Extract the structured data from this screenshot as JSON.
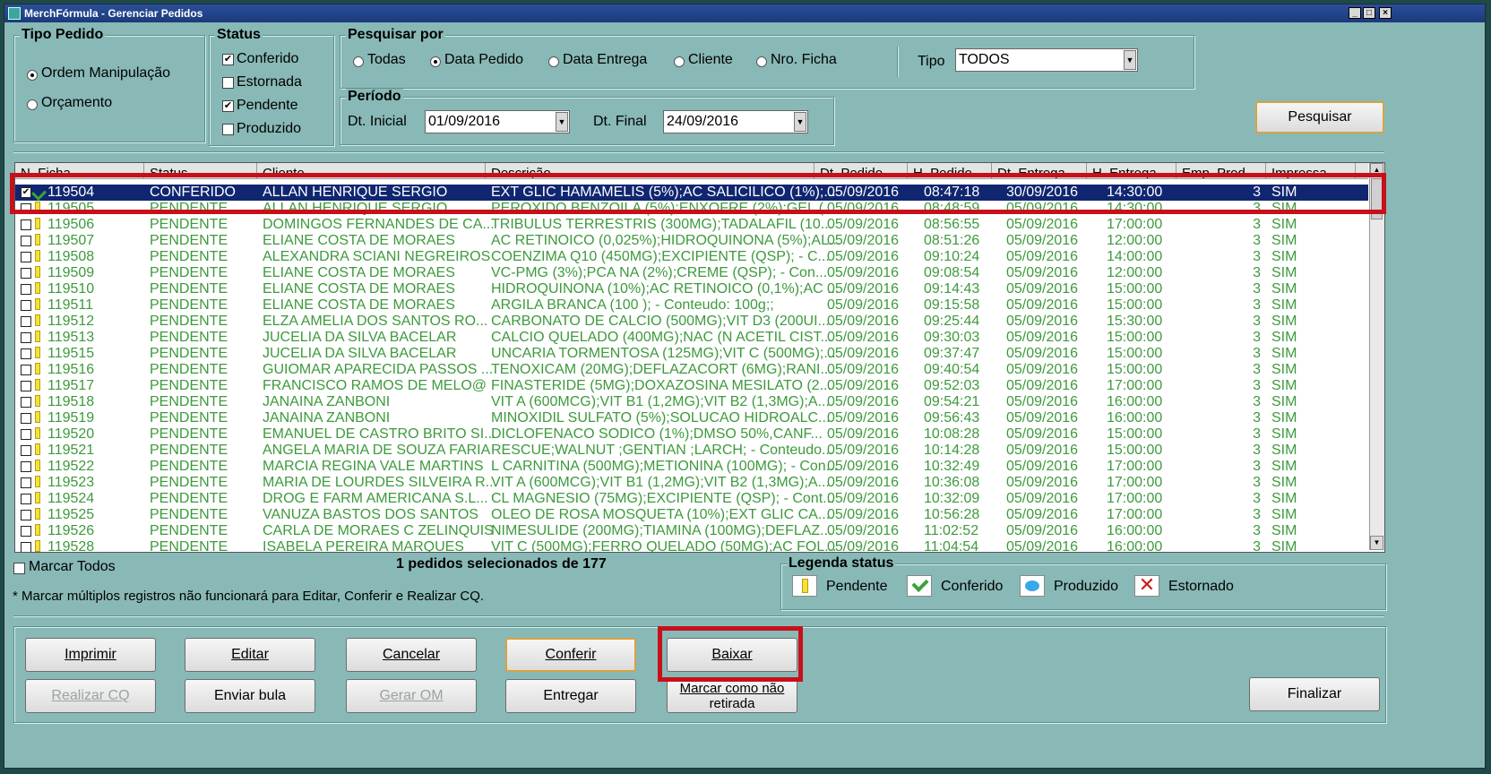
{
  "window": {
    "title": "MerchFórmula - Gerenciar Pedidos",
    "min": "_",
    "max": "□",
    "close": "×"
  },
  "tipo_pedido": {
    "label": "Tipo Pedido",
    "options": [
      "Ordem Manipulação",
      "Orçamento"
    ],
    "selected": 0
  },
  "status": {
    "label": "Status",
    "options": [
      {
        "label": "Conferido",
        "checked": true
      },
      {
        "label": "Estornada",
        "checked": false
      },
      {
        "label": "Pendente",
        "checked": true
      },
      {
        "label": "Produzido",
        "checked": false
      }
    ]
  },
  "pesquisar_por": {
    "label": "Pesquisar por",
    "options": [
      "Todas",
      "Data Pedido",
      "Data Entrega",
      "Cliente",
      "Nro. Ficha"
    ],
    "selected": 1,
    "tipo_label": "Tipo",
    "tipo_value": "TODOS"
  },
  "periodo": {
    "label": "Período",
    "dt_inicial_label": "Dt. Inicial",
    "dt_inicial": "01/09/2016",
    "dt_final_label": "Dt. Final",
    "dt_final": "24/09/2016"
  },
  "pesquisar_button": "Pesquisar",
  "columns": [
    "N. Ficha",
    "Status",
    "Cliente",
    "Descrição",
    "Dt. Pedido",
    "H. Pedido",
    "Dt. Entrega",
    "H. Entrega",
    "Emp. Prod.",
    "Impressa"
  ],
  "rows": [
    [
      "119504",
      "CONFERIDO",
      "ALLAN HENRIQUE SERGIO",
      "EXT GLIC HAMAMELIS (5%);AC SALICILICO (1%);...",
      "05/09/2016",
      "08:47:18",
      "30/09/2016",
      "14:30:00",
      "3",
      "SIM"
    ],
    [
      "119505",
      "PENDENTE",
      "ALLAN HENRIQUE SERGIO",
      "PEROXIDO BENZOILA (5%);ENXOFRE (2%);GEL (...",
      "05/09/2016",
      "08:48:59",
      "05/09/2016",
      "14:30:00",
      "3",
      "SIM"
    ],
    [
      "119506",
      "PENDENTE",
      "DOMINGOS FERNANDES DE CA...",
      "TRIBULUS TERRESTRIS (300MG);TADALAFIL (10...",
      "05/09/2016",
      "08:56:55",
      "05/09/2016",
      "17:00:00",
      "3",
      "SIM"
    ],
    [
      "119507",
      "PENDENTE",
      "ELIANE COSTA DE MORAES",
      "AC RETINOICO (0,025%);HIDROQUINONA (5%);AL...",
      "05/09/2016",
      "08:51:26",
      "05/09/2016",
      "12:00:00",
      "3",
      "SIM"
    ],
    [
      "119508",
      "PENDENTE",
      "ALEXANDRA SCIANI NEGREIROS",
      "COENZIMA Q10 (450MG);EXCIPIENTE (QSP); - C...",
      "05/09/2016",
      "09:10:24",
      "05/09/2016",
      "14:00:00",
      "3",
      "SIM"
    ],
    [
      "119509",
      "PENDENTE",
      "ELIANE COSTA DE MORAES",
      "VC-PMG (3%);PCA NA (2%);CREME (QSP); - Con...",
      "05/09/2016",
      "09:08:54",
      "05/09/2016",
      "12:00:00",
      "3",
      "SIM"
    ],
    [
      "119510",
      "PENDENTE",
      "ELIANE COSTA DE MORAES",
      "HIDROQUINONA (10%);AC RETINOICO (0,1%);AC ...",
      "05/09/2016",
      "09:14:43",
      "05/09/2016",
      "15:00:00",
      "3",
      "SIM"
    ],
    [
      "119511",
      "PENDENTE",
      "ELIANE COSTA DE MORAES",
      "ARGILA BRANCA (100    ); - Conteudo: 100g;;",
      "05/09/2016",
      "09:15:58",
      "05/09/2016",
      "15:00:00",
      "3",
      "SIM"
    ],
    [
      "119512",
      "PENDENTE",
      "ELZA AMELIA DOS SANTOS RO...",
      "CARBONATO DE  CALCIO (500MG);VIT D3 (200UI...",
      "05/09/2016",
      "09:25:44",
      "05/09/2016",
      "15:30:00",
      "3",
      "SIM"
    ],
    [
      "119513",
      "PENDENTE",
      "JUCELIA DA SILVA BACELAR",
      "CALCIO QUELADO (400MG);NAC (N ACETIL CIST...",
      "05/09/2016",
      "09:30:03",
      "05/09/2016",
      "15:00:00",
      "3",
      "SIM"
    ],
    [
      "119515",
      "PENDENTE",
      "JUCELIA DA SILVA BACELAR",
      "UNCARIA TORMENTOSA (125MG);VIT C (500MG);...",
      "05/09/2016",
      "09:37:47",
      "05/09/2016",
      "15:00:00",
      "3",
      "SIM"
    ],
    [
      "119516",
      "PENDENTE",
      "GUIOMAR APARECIDA PASSOS ...",
      "TENOXICAM (20MG);DEFLAZACORT (6MG);RANI...",
      "05/09/2016",
      "09:40:54",
      "05/09/2016",
      "15:00:00",
      "3",
      "SIM"
    ],
    [
      "119517",
      "PENDENTE",
      "FRANCISCO RAMOS DE MELO@",
      "FINASTERIDE (5MG);DOXAZOSINA MESILATO (2...",
      "05/09/2016",
      "09:52:03",
      "05/09/2016",
      "17:00:00",
      "3",
      "SIM"
    ],
    [
      "119518",
      "PENDENTE",
      "JANAINA ZANBONI",
      "VIT A (600MCG);VIT B1 (1,2MG);VIT B2 (1,3MG);A...",
      "05/09/2016",
      "09:54:21",
      "05/09/2016",
      "16:00:00",
      "3",
      "SIM"
    ],
    [
      "119519",
      "PENDENTE",
      "JANAINA ZANBONI",
      "MINOXIDIL SULFATO (5%);SOLUCAO HIDROALC...",
      "05/09/2016",
      "09:56:43",
      "05/09/2016",
      "16:00:00",
      "3",
      "SIM"
    ],
    [
      "119520",
      "PENDENTE",
      "EMANUEL DE CASTRO BRITO SI...",
      "DICLOFENACO SODICO (1%);DMSO 50%,CANF...",
      "05/09/2016",
      "10:08:28",
      "05/09/2016",
      "15:00:00",
      "3",
      "SIM"
    ],
    [
      "119521",
      "PENDENTE",
      "ANGELA MARIA DE SOUZA FARIA",
      "RESCUE;WALNUT ;GENTIAN ;LARCH; - Conteudo...",
      "05/09/2016",
      "10:14:28",
      "05/09/2016",
      "15:00:00",
      "3",
      "SIM"
    ],
    [
      "119522",
      "PENDENTE",
      "MARCIA REGINA VALE MARTINS",
      "L CARNITINA (500MG);METIONINA (100MG); - Con...",
      "05/09/2016",
      "10:32:49",
      "05/09/2016",
      "17:00:00",
      "3",
      "SIM"
    ],
    [
      "119523",
      "PENDENTE",
      "MARIA DE LOURDES SILVEIRA R...",
      "VIT A (600MCG);VIT B1 (1,2MG);VIT B2 (1,3MG);A...",
      "05/09/2016",
      "10:36:08",
      "05/09/2016",
      "17:00:00",
      "3",
      "SIM"
    ],
    [
      "119524",
      "PENDENTE",
      "DROG E FARM AMERICANA S.L...",
      "CL MAGNESIO (75MG);EXCIPIENTE (QSP); - Cont...",
      "05/09/2016",
      "10:32:09",
      "05/09/2016",
      "17:00:00",
      "3",
      "SIM"
    ],
    [
      "119525",
      "PENDENTE",
      "VANUZA BASTOS DOS SANTOS",
      "OLEO DE ROSA MOSQUETA (10%);EXT GLIC CA...",
      "05/09/2016",
      "10:56:28",
      "05/09/2016",
      "17:00:00",
      "3",
      "SIM"
    ],
    [
      "119526",
      "PENDENTE",
      "CARLA DE MORAES C ZELINQUIS",
      "NIMESULIDE (200MG);TIAMINA (100MG);DEFLAZ...",
      "05/09/2016",
      "11:02:52",
      "05/09/2016",
      "16:00:00",
      "3",
      "SIM"
    ],
    [
      "119528",
      "PENDENTE",
      "ISABELA PEREIRA MARQUES",
      "VIT C (500MG);FERRO QUELADO (50MG);AC FOL...",
      "05/09/2016",
      "11:04:54",
      "05/09/2016",
      "16:00:00",
      "3",
      "SIM"
    ]
  ],
  "selected_row": 0,
  "marcar_todos": "Marcar Todos",
  "selection_count": "1 pedidos selecionados de 177",
  "note": "* Marcar múltiplos registros não funcionará para Editar, Conferir e Realizar CQ.",
  "legenda": {
    "label": "Legenda status",
    "items": [
      "Pendente",
      "Conferido",
      "Produzido",
      "Estornado"
    ]
  },
  "buttons": {
    "imprimir": "Imprimir",
    "editar": "Editar",
    "cancelar": "Cancelar",
    "conferir": "Conferir",
    "baixar": "Baixar",
    "realizar_cq": "Realizar CQ",
    "enviar_bula": "Enviar bula",
    "gerar_om": "Gerar OM",
    "entregar": "Entregar",
    "marcar_nao_retirada_1": "Marcar como não",
    "marcar_nao_retirada_2": "retirada",
    "finalizar": "Finalizar"
  },
  "colors": {
    "background": "#88b9b6",
    "selected_row": "#102670",
    "pendente_text": "#3d9a3d",
    "highlight": "#c8101a"
  }
}
